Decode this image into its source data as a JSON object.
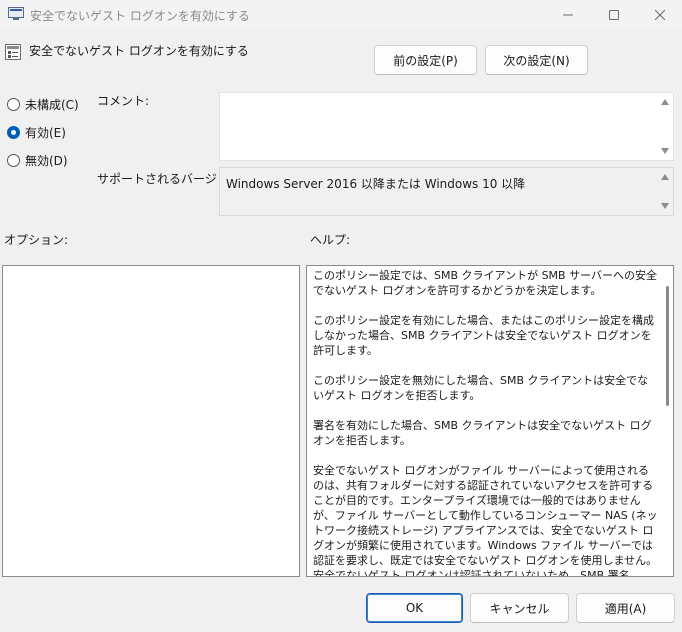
{
  "window": {
    "title": "安全でないゲスト ログオンを有効にする"
  },
  "header": {
    "title": "安全でないゲスト ログオンを有効にする",
    "prev_label": "前の設定(P)",
    "next_label": "次の設定(N)"
  },
  "state": {
    "options": [
      {
        "label": "未構成(C)",
        "checked": false
      },
      {
        "label": "有効(E)",
        "checked": true
      },
      {
        "label": "無効(D)",
        "checked": false
      }
    ]
  },
  "comment": {
    "label": "コメント:",
    "value": ""
  },
  "supported": {
    "label": "サポートされるバージョン:",
    "value": "Windows Server 2016 以降または Windows 10 以降"
  },
  "options_panel": {
    "label": "オプション:"
  },
  "help": {
    "label": "ヘルプ:",
    "paragraphs": [
      "このポリシー設定では、SMB クライアントが SMB サーバーへの安全でないゲスト ログオンを許可するかどうかを決定します。",
      "このポリシー設定を有効にした場合、またはこのポリシー設定を構成しなかった場合、SMB クライアントは安全でないゲスト ログオンを許可します。",
      "このポリシー設定を無効にした場合、SMB クライアントは安全でないゲスト ログオンを拒否します。",
      "署名を有効にした場合、SMB クライアントは安全でないゲスト ログオンを拒否します。",
      "安全でないゲスト ログオンがファイル サーバーによって使用されるのは、共有フォルダーに対する認証されていないアクセスを許可することが目的です。エンタープライズ環境では一般的ではありませんが、ファイル サーバーとして動作しているコンシューマー NAS (ネットワーク接続ストレージ) アプライアンスでは、安全でないゲスト ログオンが頻繁に使用されています。Windows ファイル サーバーでは認証を要求し、既定では安全でないゲスト ログオンを使用しません。安全でないゲスト ログオンは認証されていないため、SMB 署名、SMB 暗号化などの重要なセキュリティ機能が無効になります。結果として、安全でないゲスト ログオンを許可するクライアントは、さまざまな"
    ]
  },
  "footer": {
    "ok_label": "OK",
    "cancel_label": "キャンセル",
    "apply_label": "適用(A)"
  }
}
